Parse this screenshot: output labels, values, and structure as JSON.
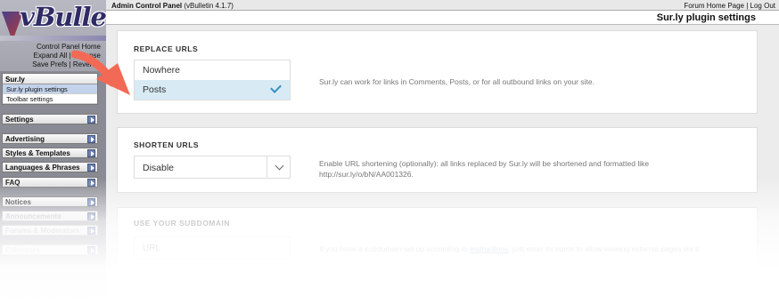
{
  "logo": {
    "text": "vBulletin"
  },
  "cp_links": [
    "Control Panel Home",
    "Expand All | Collapse",
    "Save Prefs | Revert P"
  ],
  "nav_active": {
    "head": "Sur.ly",
    "items": [
      "Sur.ly plugin settings",
      "Toolbar settings"
    ]
  },
  "nav_groups": [
    "Settings",
    "Advertising",
    "Styles & Templates",
    "Languages & Phrases",
    "FAQ",
    "Notices",
    "Announcements",
    "Forums & Moderators",
    "Calendars"
  ],
  "topbar": {
    "title": "Admin Control Panel",
    "version": "(vBulletin 4.1.7)",
    "links": "Forum Home Page | Log Out"
  },
  "page_title": "Sur.ly plugin settings",
  "replace_urls": {
    "title": "REPLACE URLS",
    "options": [
      "Nowhere",
      "Posts"
    ],
    "selected": "Posts",
    "description": "Sur.ly can work for links in Comments, Posts, or for all outbound links on your site."
  },
  "shorten_urls": {
    "title": "SHORTEN URLS",
    "value": "Disable",
    "description_1": "Enable URL shortening (optionally): all links replaced by Sur.ly will be shortened and formatted like",
    "description_2": "http://sur.ly/o/bN/AA001326."
  },
  "subdomain": {
    "title": "USE YOUR SUBDOMAIN",
    "placeholder": "URL",
    "description_pre": "If you have a subdomain set up according to",
    "link": "instructions",
    "description_post": ", just enter its name to allow viewing external pages via it."
  },
  "colors": {
    "accent": "#3a8fc2",
    "selected_bg": "#d8ebf4",
    "pointer": "#f26a55"
  }
}
